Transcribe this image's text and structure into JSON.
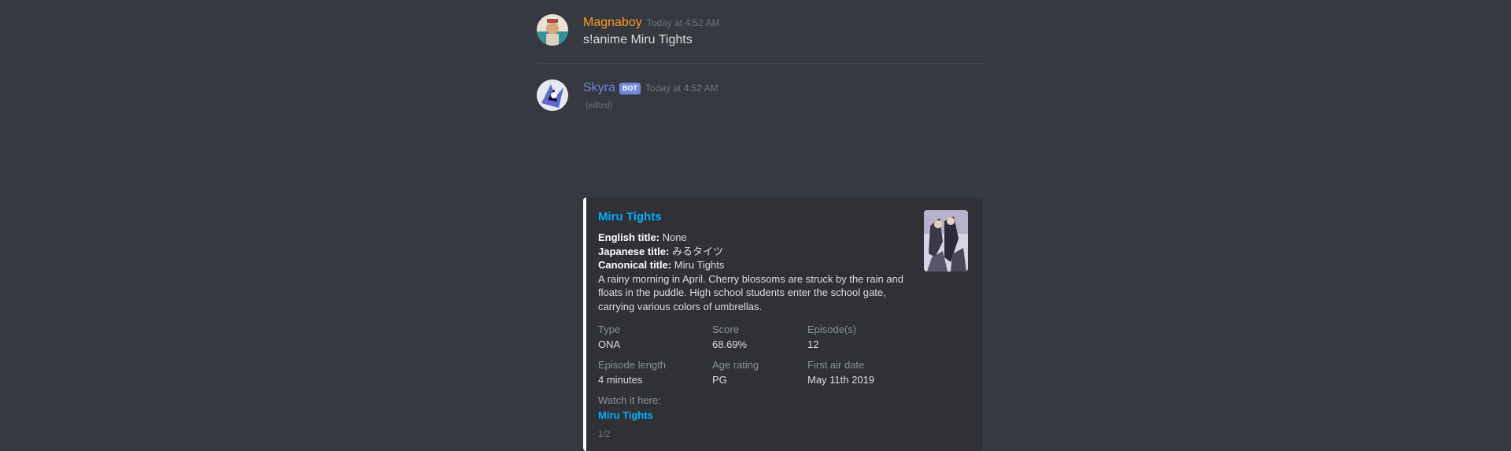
{
  "messages": [
    {
      "username": "Magnaboy",
      "username_color": "#f89b26",
      "timestamp": "Today at 4:52 AM",
      "text": "s!anime Miru Tights",
      "avatar_icon": "user-avatar"
    },
    {
      "username": "Skyra",
      "username_color": "#7289da",
      "bot_tag": "BOT",
      "timestamp": "Today at 4:52 AM",
      "edited": "(edited)",
      "avatar_icon": "bot-avatar"
    }
  ],
  "embed": {
    "border_color": "#ffffff",
    "title": "Miru Tights",
    "english_title_label": "English title:",
    "english_title": " None",
    "japanese_title_label": "Japanese title:",
    "japanese_title": " みるタイツ",
    "canonical_title_label": "Canonical title:",
    "canonical_title": " Miru Tights",
    "synopsis": "A rainy morning in April. Cherry blossoms are struck by the rain and floats in the puddle. High school students enter the school gate, carrying various colors of umbrellas.",
    "fields": {
      "type_name": "Type",
      "type_value": "ONA",
      "score_name": "Score",
      "score_value": "68.69%",
      "episodes_name": "Episode(s)",
      "episodes_value": "12",
      "length_name": "Episode length",
      "length_value": "4 minutes",
      "age_name": "Age rating",
      "age_value": "PG",
      "air_name": "First air date",
      "air_value": "May 11th 2019",
      "watch_name": "Watch it here:",
      "watch_link": "Miru Tights"
    },
    "footer": "1/2",
    "thumbnail_icon": "anime-cover-thumbnail"
  }
}
